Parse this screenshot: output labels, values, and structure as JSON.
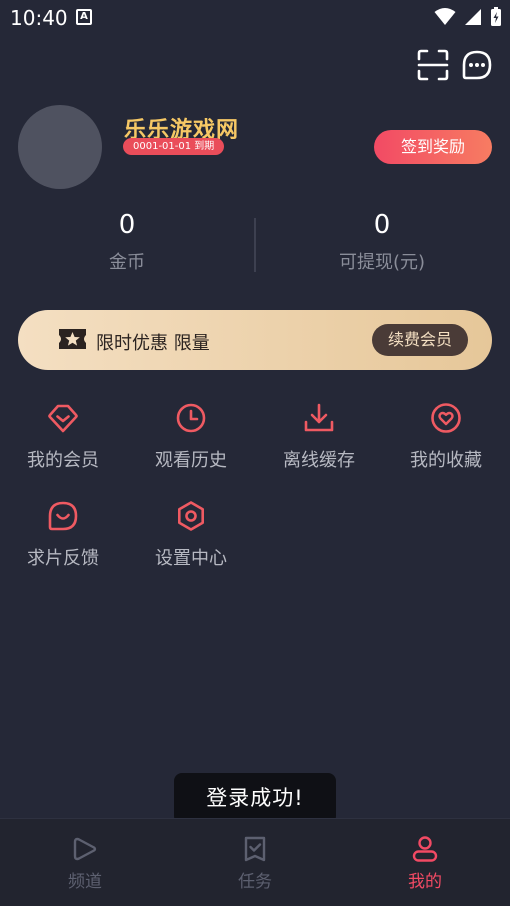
{
  "status_bar": {
    "time": "10:40",
    "a_icon": "A"
  },
  "profile": {
    "username": "乐乐游戏网",
    "expire": "0001-01-01 到期",
    "checkin_label": "签到奖励"
  },
  "stats": [
    {
      "value": "0",
      "label": "金币"
    },
    {
      "value": "0",
      "label": "可提现(元)"
    }
  ],
  "vip": {
    "text": "限时优惠 限量",
    "button": "续费会员"
  },
  "grid": [
    {
      "label": "我的会员",
      "icon": "diamond-icon"
    },
    {
      "label": "观看历史",
      "icon": "clock-icon"
    },
    {
      "label": "离线缓存",
      "icon": "download-icon"
    },
    {
      "label": "我的收藏",
      "icon": "heart-icon"
    },
    {
      "label": "求片反馈",
      "icon": "chat-smile-icon"
    },
    {
      "label": "设置中心",
      "icon": "settings-icon"
    }
  ],
  "toast": "登录成功!",
  "nav": [
    {
      "label": "频道",
      "icon": "play-icon",
      "active": false
    },
    {
      "label": "任务",
      "icon": "task-icon",
      "active": false
    },
    {
      "label": "我的",
      "icon": "user-icon",
      "active": true
    }
  ],
  "colors": {
    "background": "#252837",
    "accent": "#f24a64",
    "gold": "#f6c865",
    "icon_red": "#ef5a62",
    "nav_inactive": "#5d6070"
  }
}
